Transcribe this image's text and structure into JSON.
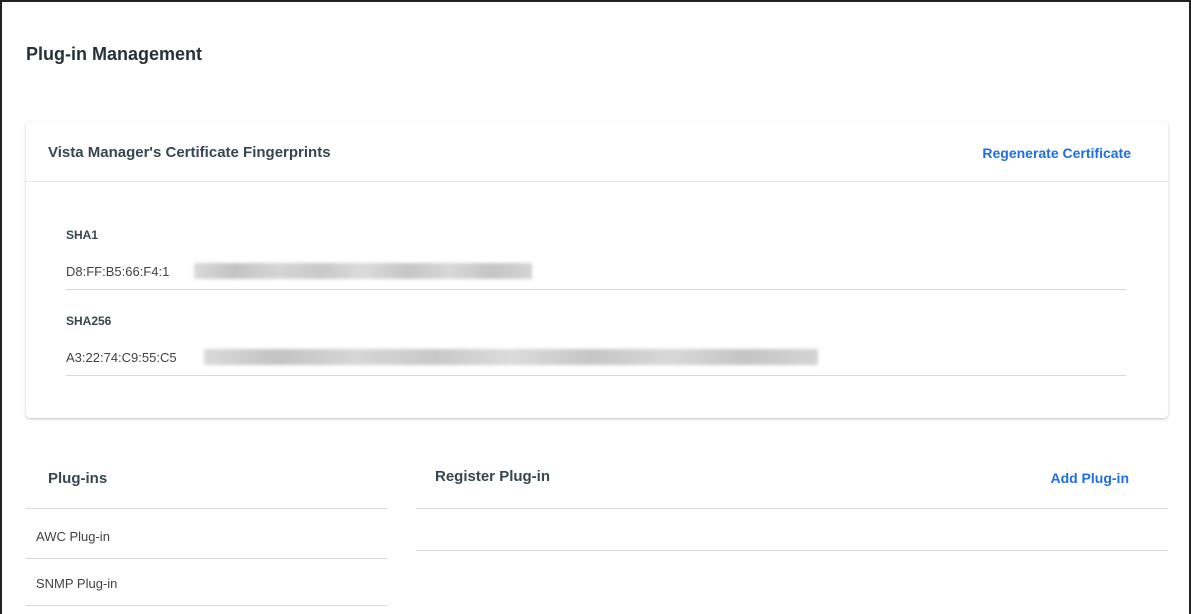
{
  "page": {
    "title": "Plug-in Management"
  },
  "certificate": {
    "title": "Vista Manager's Certificate Fingerprints",
    "regenerate_label": "Regenerate Certificate",
    "sha1": {
      "label": "SHA1",
      "value": "D8:FF:B5:66:F4:1"
    },
    "sha256": {
      "label": "SHA256",
      "value": "A3:22:74:C9:55:C5"
    }
  },
  "plugins": {
    "header": "Plug-ins",
    "items": [
      {
        "label": "AWC Plug-in"
      },
      {
        "label": "SNMP Plug-in"
      }
    ]
  },
  "register": {
    "header": "Register Plug-in",
    "add_label": "Add Plug-in"
  },
  "colors": {
    "link": "#1e6ee6",
    "heading": "#37474f",
    "divider": "#d9d9d9"
  }
}
